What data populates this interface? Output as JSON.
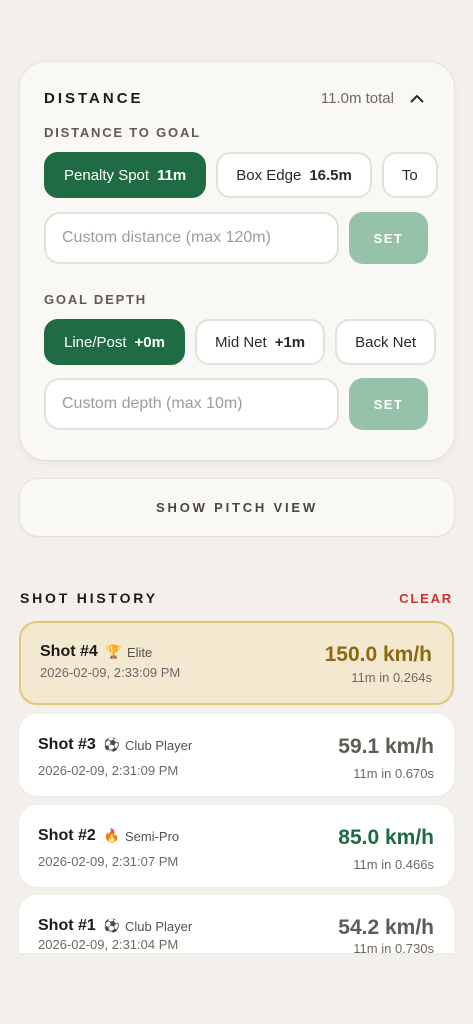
{
  "distance": {
    "title": "DISTANCE",
    "total": "11.0m total",
    "to_goal_label": "DISTANCE TO GOAL",
    "presets": [
      {
        "name": "Penalty Spot",
        "value": "11m",
        "active": true
      },
      {
        "name": "Box Edge",
        "value": "16.5m",
        "active": false
      },
      {
        "name": "To",
        "value": "",
        "active": false
      }
    ],
    "custom_distance_placeholder": "Custom distance (max 120m)",
    "set_label": "SET",
    "depth_label": "GOAL DEPTH",
    "depths": [
      {
        "name": "Line/Post",
        "value": "+0m",
        "active": true
      },
      {
        "name": "Mid Net",
        "value": "+1m",
        "active": false
      },
      {
        "name": "Back Net",
        "value": "",
        "active": false
      }
    ],
    "custom_depth_placeholder": "Custom depth (max 10m)",
    "set_label_2": "SET"
  },
  "pitch_button": "SHOW PITCH VIEW",
  "history": {
    "title": "SHOT HISTORY",
    "clear": "CLEAR",
    "shots": [
      {
        "title": "Shot #4",
        "emoji": "🏆",
        "rank": "Elite",
        "date": "2026-02-09, 2:33:09 PM",
        "speed": "150.0 km/h",
        "meta": "11m in 0.264s"
      },
      {
        "title": "Shot #3",
        "emoji": "⚽",
        "rank": "Club Player",
        "date": "2026-02-09, 2:31:09 PM",
        "speed": "59.1 km/h",
        "meta": "11m in 0.670s"
      },
      {
        "title": "Shot #2",
        "emoji": "🔥",
        "rank": "Semi-Pro",
        "date": "2026-02-09, 2:31:07 PM",
        "speed": "85.0 km/h",
        "meta": "11m in 0.466s"
      },
      {
        "title": "Shot #1",
        "emoji": "⚽",
        "rank": "Club Player",
        "date": "2026-02-09, 2:31:04 PM",
        "speed": "54.2 km/h",
        "meta": "11m in 0.730s"
      }
    ]
  },
  "colors": {
    "accent": "#1e6b44",
    "clear": "#d0302a",
    "best_bg": "#f3e9d1",
    "best_speed": "#8c6a12"
  }
}
